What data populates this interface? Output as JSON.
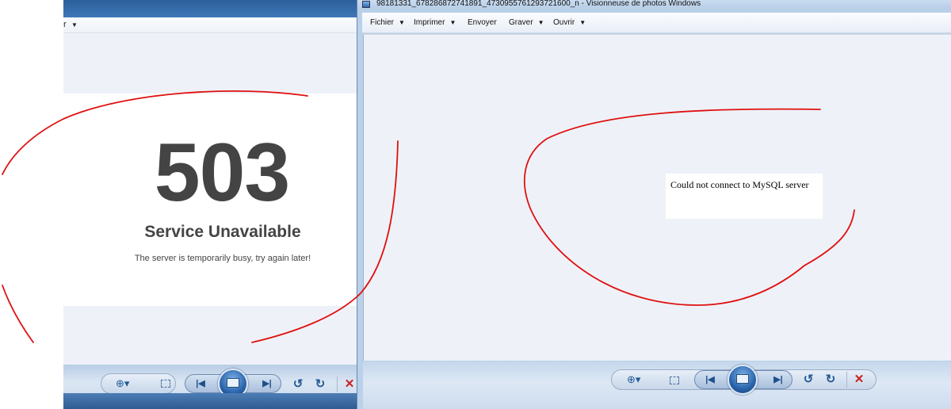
{
  "left_window": {
    "menu_fragment": "r",
    "error": {
      "code": "503",
      "title": "Service Unavailable",
      "message": "The server is temporarily busy, try again later!"
    }
  },
  "right_window": {
    "title": "98181331_678286872741891_4730955761293721600_n - Visionneuse de photos Windows",
    "menu": [
      "Fichier",
      "Imprimer",
      "Envoyer",
      "Graver",
      "Ouvrir"
    ],
    "photo_text": "Could not connect to MySQL server"
  },
  "annotation_color": "#e01010",
  "icons": [
    "zoom-icon",
    "fit-window-icon",
    "previous-icon",
    "slideshow-icon",
    "next-icon",
    "rotate-left-icon",
    "rotate-right-icon",
    "delete-icon"
  ]
}
